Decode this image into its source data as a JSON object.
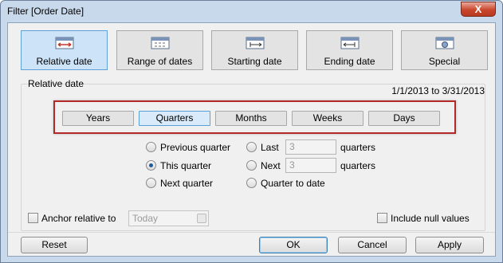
{
  "window": {
    "title": "Filter [Order Date]",
    "close_glyph": "X"
  },
  "modes": [
    {
      "label": "Relative date",
      "icon": "relative-date-icon",
      "selected": true
    },
    {
      "label": "Range of dates",
      "icon": "date-range-icon",
      "selected": false
    },
    {
      "label": "Starting date",
      "icon": "starting-date-icon",
      "selected": false
    },
    {
      "label": "Ending date",
      "icon": "ending-date-icon",
      "selected": false
    },
    {
      "label": "Special",
      "icon": "special-icon",
      "selected": false
    }
  ],
  "relative": {
    "section_label": "Relative date",
    "date_range": "1/1/2013 to 3/31/2013",
    "units": [
      "Years",
      "Quarters",
      "Months",
      "Weeks",
      "Days"
    ],
    "selected_unit": "Quarters",
    "options": {
      "previous": "Previous quarter",
      "this": "This quarter",
      "next": "Next quarter",
      "last": "Last",
      "next_n": "Next",
      "to_date": "Quarter to date"
    },
    "selected_option": "This quarter",
    "last_value": "3",
    "next_value": "3",
    "unit_word": "quarters"
  },
  "anchor": {
    "label": "Anchor relative to",
    "value": "Today",
    "checked": false
  },
  "include_null": {
    "label": "Include null values",
    "checked": false
  },
  "buttons": {
    "reset": "Reset",
    "ok": "OK",
    "cancel": "Cancel",
    "apply": "Apply"
  },
  "colors": {
    "selection": "#cde3f7",
    "highlight_box": "#b52828",
    "frame": "#c9d9ec"
  }
}
